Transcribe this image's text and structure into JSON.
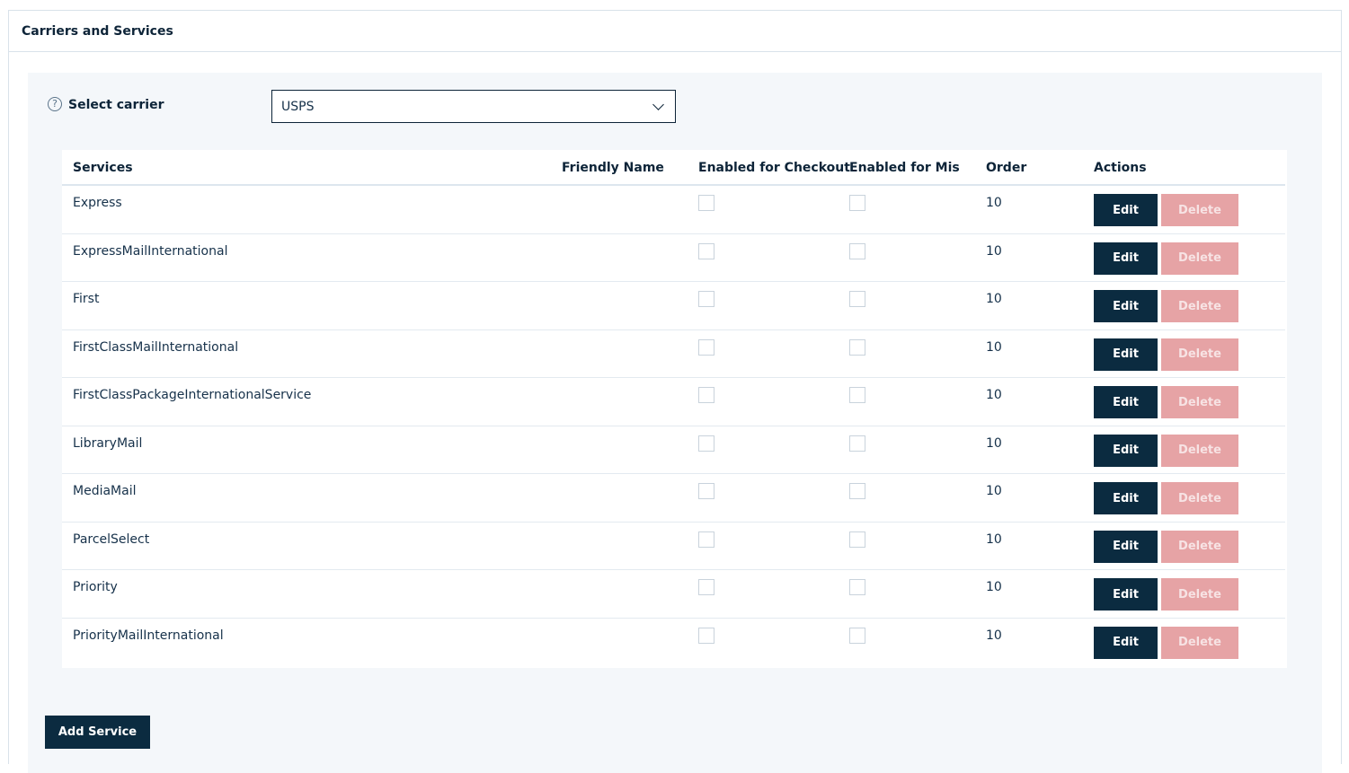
{
  "panel": {
    "title": "Carriers and Services"
  },
  "carrier": {
    "help_icon": "question-circle-icon",
    "label": "Select carrier",
    "selected": "USPS"
  },
  "table": {
    "headers": {
      "services": "Services",
      "friendly_name": "Friendly Name",
      "enabled_checkout": "Enabled for Checkout",
      "enabled_mis": "Enabled for Mis",
      "order": "Order",
      "actions": "Actions"
    },
    "rows": [
      {
        "service": "Express",
        "friendly_name": "",
        "order": "10",
        "enabled_checkout": false,
        "enabled_mis": false
      },
      {
        "service": "ExpressMailInternational",
        "friendly_name": "",
        "order": "10",
        "enabled_checkout": false,
        "enabled_mis": false
      },
      {
        "service": "First",
        "friendly_name": "",
        "order": "10",
        "enabled_checkout": false,
        "enabled_mis": false
      },
      {
        "service": "FirstClassMailInternational",
        "friendly_name": "",
        "order": "10",
        "enabled_checkout": false,
        "enabled_mis": false
      },
      {
        "service": "FirstClassPackageInternationalService",
        "friendly_name": "",
        "order": "10",
        "enabled_checkout": false,
        "enabled_mis": false
      },
      {
        "service": "LibraryMail",
        "friendly_name": "",
        "order": "10",
        "enabled_checkout": false,
        "enabled_mis": false
      },
      {
        "service": "MediaMail",
        "friendly_name": "",
        "order": "10",
        "enabled_checkout": false,
        "enabled_mis": false
      },
      {
        "service": "ParcelSelect",
        "friendly_name": "",
        "order": "10",
        "enabled_checkout": false,
        "enabled_mis": false
      },
      {
        "service": "Priority",
        "friendly_name": "",
        "order": "10",
        "enabled_checkout": false,
        "enabled_mis": false
      },
      {
        "service": "PriorityMailInternational",
        "friendly_name": "",
        "order": "10",
        "enabled_checkout": false,
        "enabled_mis": false
      }
    ],
    "edit_label": "Edit",
    "delete_label": "Delete"
  },
  "add_service_label": "Add Service",
  "colors": {
    "primary": "#0b2b40",
    "danger_disabled": "#e6a3a5",
    "content_bg": "#f4f7fa"
  }
}
